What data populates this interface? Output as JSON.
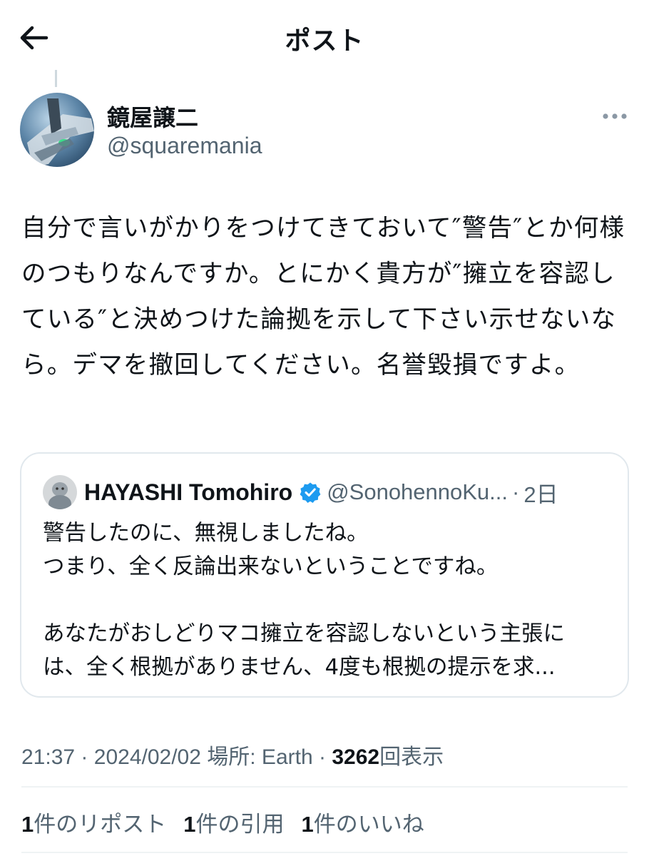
{
  "header": {
    "title": "ポスト",
    "back_icon": "arrow-left-icon"
  },
  "post": {
    "author": {
      "name": "鏡屋譲二",
      "handle": "@squaremania"
    },
    "more_icon": "more-horizontal-icon",
    "text": "自分で言いがかりをつけてきておいて″警告″とか何様のつもりなんですか。とにかく貴方が″擁立を容認している″と決めつけた論拠を示して下さい示せないなら。デマを撤回してください。名誉毀損ですよ。",
    "quote": {
      "author_name": "HAYASHI Tomohiro",
      "verified_icon": "verified-badge-icon",
      "handle": "@SonohennoKu...",
      "separator": "·",
      "date": "2日",
      "lines": [
        "警告したのに、無視しましたね。",
        "つまり、全く反論出来ないということですね。",
        "",
        "あなたがおしどりマコ擁立を容認しないという主張に",
        "は、全く根拠がありません、4度も根拠の提示を求..."
      ]
    },
    "meta": {
      "time": "21:37",
      "sep1": "·",
      "date": "2024/02/02",
      "location_label": "場所: Earth",
      "sep2": "·",
      "views_count": "3262",
      "views_label": "回表示"
    },
    "stats": [
      {
        "count": "1",
        "label": "件のリポスト"
      },
      {
        "count": "1",
        "label": "件の引用"
      },
      {
        "count": "1",
        "label": "件のいいね"
      }
    ]
  },
  "colors": {
    "text": "#0f1419",
    "secondary": "#536471",
    "verified": "#1d9bf0",
    "border": "#e1e8ed"
  }
}
